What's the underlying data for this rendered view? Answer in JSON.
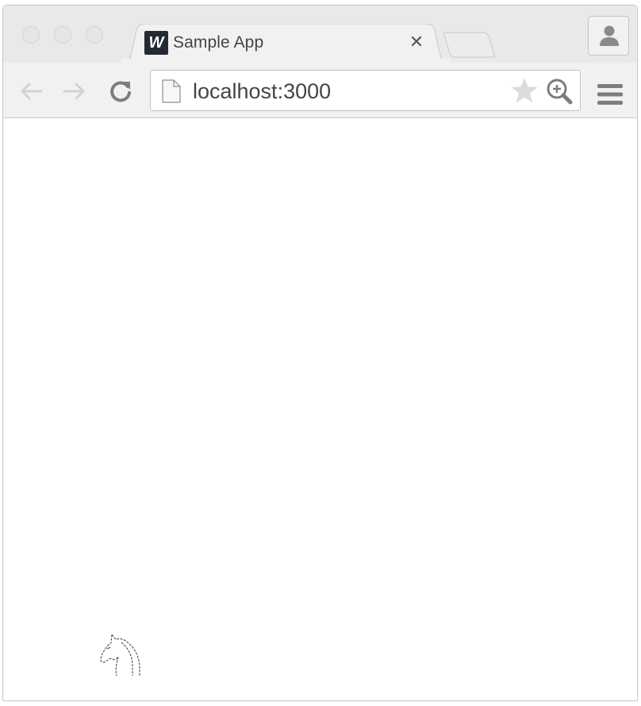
{
  "browser": {
    "tab": {
      "favicon_letter": "W",
      "title": "Sample App",
      "close_glyph": "✕"
    },
    "address_bar": {
      "url": "localhost:3000"
    },
    "icons": {
      "back": "arrow-left-icon",
      "forward": "arrow-right-icon",
      "reload": "reload-icon",
      "page": "page-icon",
      "bookmark": "star-icon",
      "zoom": "zoom-in-icon",
      "menu": "hamburger-menu-icon",
      "profile": "person-icon"
    },
    "colors": {
      "favicon_bg": "#232a33",
      "titlebar_bg": "#e9e9e9",
      "toolbar_bg": "#f1f1f1"
    }
  },
  "page": {
    "logo": "horse-head-logo"
  }
}
